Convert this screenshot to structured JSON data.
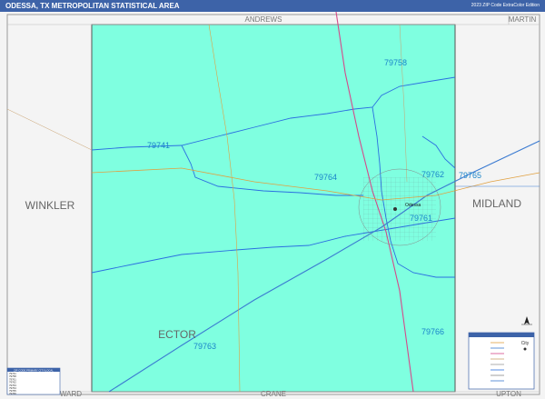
{
  "header": {
    "title": "ODESSA, TX METROPOLITAN STATISTICAL AREA",
    "subtitle": "2023 ZIP Code ExtraColor Edition"
  },
  "neighbors": {
    "top_left": "ANDREWS",
    "top_right": "MARTIN",
    "left": "WINKLER",
    "right": "MIDLAND",
    "bottom_left": "WARD",
    "bottom_mid": "CRANE",
    "bottom_right": "UPTON"
  },
  "county": {
    "name": "ECTOR"
  },
  "city": {
    "name": "Odessa"
  },
  "zip_codes": [
    {
      "code": "79758"
    },
    {
      "code": "79741"
    },
    {
      "code": "79764"
    },
    {
      "code": "79762"
    },
    {
      "code": "79765"
    },
    {
      "code": "79761"
    },
    {
      "code": "79766"
    },
    {
      "code": "79763"
    }
  ],
  "legend": {
    "header": "",
    "city_label": "City"
  },
  "zip_table": {
    "header": "ZIP CODE PRIMARY CITY/LOCAL",
    "rows": [
      "79741",
      "79758",
      "79761",
      "79762",
      "79763",
      "79764",
      "79765",
      "79766"
    ]
  },
  "colors": {
    "county_fill": "#7fffe0",
    "neighbor_fill": "#f4f4f4",
    "title_bar": "#3d63a8",
    "zip_label": "#1a84c9"
  }
}
